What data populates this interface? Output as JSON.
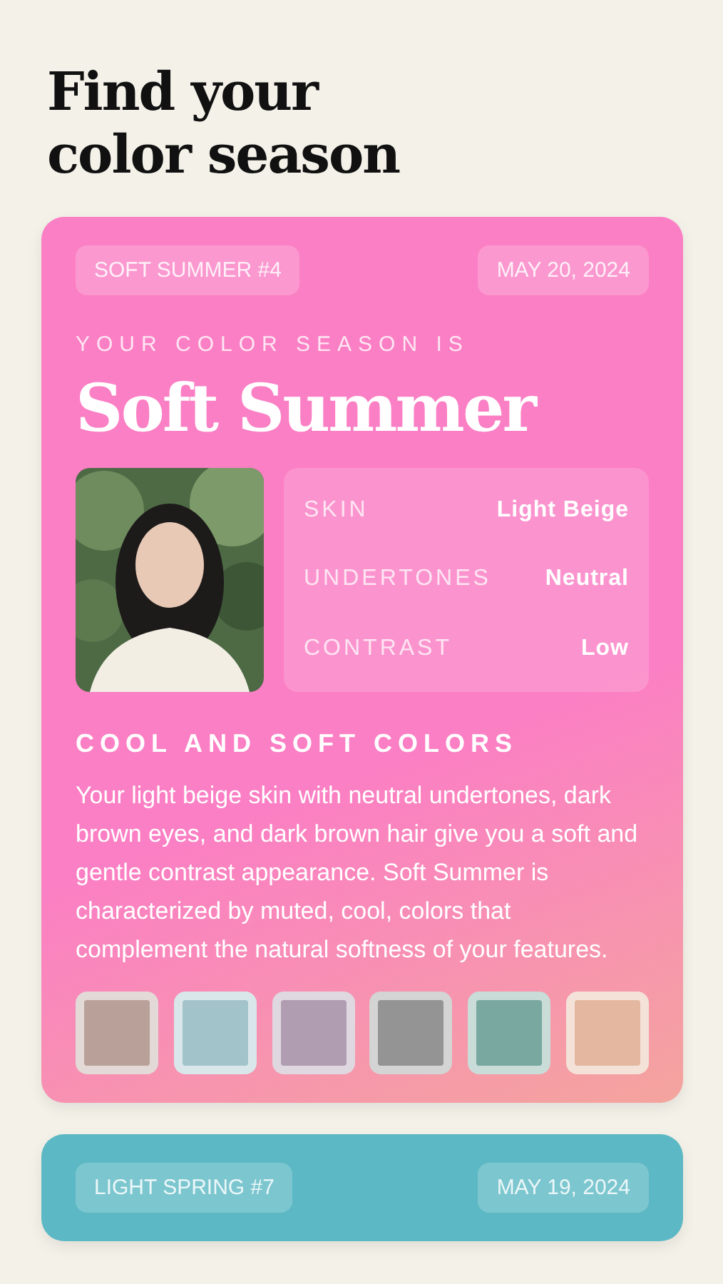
{
  "title": "Find your color season",
  "cards": [
    {
      "tag": "SOFT SUMMER #4",
      "date": "MAY 20, 2024",
      "color": "#fb7fc4",
      "eyebrow": "YOUR COLOR SEASON IS",
      "season": "Soft Summer",
      "traits": [
        {
          "label": "SKIN",
          "value": "Light Beige"
        },
        {
          "label": "UNDERTONES",
          "value": "Neutral"
        },
        {
          "label": "CONTRAST",
          "value": "Low"
        }
      ],
      "subtitle": "COOL AND SOFT COLORS",
      "description": "Your light beige skin with neutral undertones, dark brown eyes, and dark brown hair give you a soft and gentle contrast appearance. Soft Summer is characterized by muted, cool, colors that complement the natural softness of your features.",
      "swatches": [
        {
          "color": "#b9a19a"
        },
        {
          "color": "#a3c3cb"
        },
        {
          "color": "#b19db1"
        },
        {
          "color": "#949494"
        },
        {
          "color": "#78a89f"
        },
        {
          "color": "#e3b7a0"
        }
      ]
    },
    {
      "tag": "LIGHT SPRING #7",
      "date": "MAY 19, 2024",
      "color": "#5cb8c4"
    }
  ]
}
